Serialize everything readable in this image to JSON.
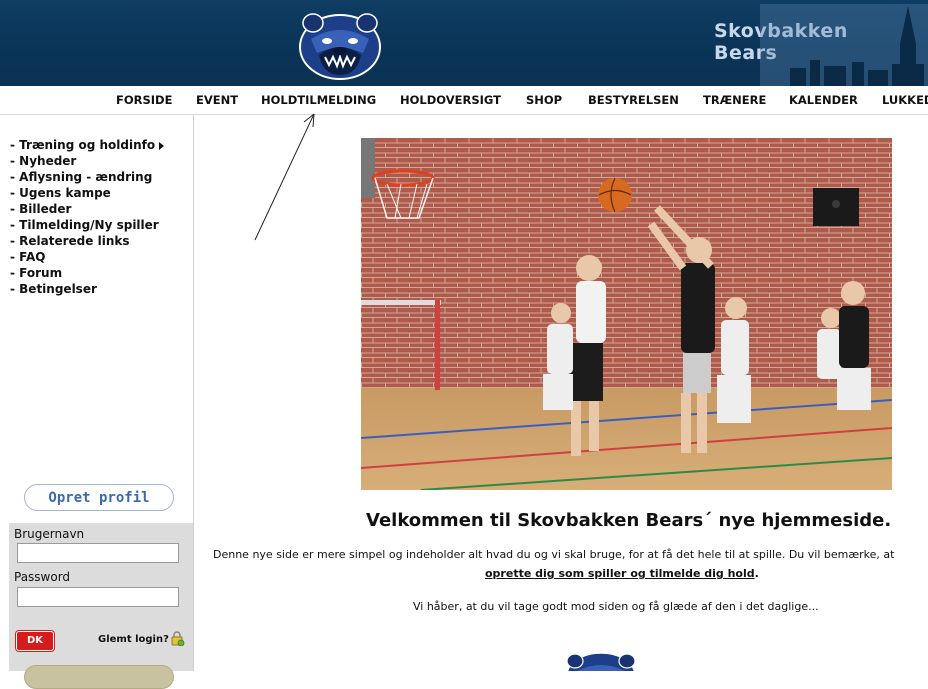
{
  "header": {
    "club_name_line1": "Skovbakken",
    "club_name_line2": "Bears",
    "logo_icon": "bear-head-logo"
  },
  "nav": {
    "items": [
      "FORSIDE",
      "EVENT",
      "HOLDTILMELDING",
      "HOLDOVERSIGT",
      "SHOP",
      "BESTYRELSEN",
      "TRÆNERE",
      "KALENDER",
      "LUKKED"
    ]
  },
  "sidebar": {
    "menu": [
      "- Træning og holdinfo",
      "- Nyheder",
      "- Aflysning - ændring",
      "- Ugens kampe",
      "- Billeder",
      "- Tilmelding/Ny spiller",
      "- Relaterede links",
      "- FAQ",
      "- Forum",
      "- Betingelser"
    ],
    "create_profile": "Opret profil",
    "login": {
      "username_label": "Brugernavn",
      "password_label": "Password",
      "username_value": "",
      "password_value": "",
      "badge": "DK",
      "forgot": "Glemt login?"
    }
  },
  "main": {
    "welcome": "Velkommen til Skovbakken Bears´ nye hjemmeside.",
    "intro": "Denne nye side er mere simpel og indeholder alt hvad du og vi skal bruge, for at få det hele til at spille. Du vil bemærke, at",
    "intro_link": "oprette dig som spiller og tilmelde dig hold",
    "intro_link_suffix": ".",
    "closing": "Vi håber, at du vil tage godt mod siden og få glæde af den i det daglige..."
  },
  "colors": {
    "banner": "#0a3457",
    "nav_text": "#111111",
    "button_border": "#9db7d4",
    "button_text": "#3b6aa8",
    "badge_red": "#d41c1c"
  }
}
